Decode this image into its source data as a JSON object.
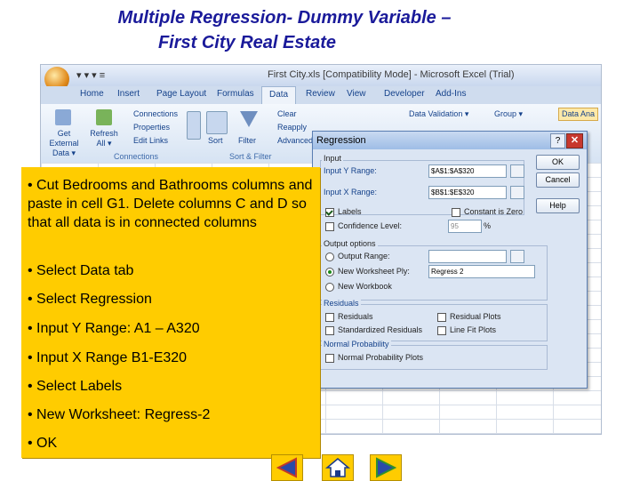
{
  "slide": {
    "title_line1": "Multiple Regression- Dummy Variable –",
    "title_line2": "First City Real Estate"
  },
  "excel": {
    "qat": "▾ ▾ ▾  ≡",
    "window_title": "First City.xls  [Compatibility Mode] - Microsoft Excel (Trial)",
    "tabs": [
      "Home",
      "Insert",
      "Page Layout",
      "Formulas",
      "Data",
      "Review",
      "View",
      "Developer",
      "Add-Ins"
    ],
    "active_tab": "Data",
    "ribbon": {
      "get_external": "Get External\nData ▾",
      "refresh": "Refresh\nAll ▾",
      "connections": "Connections",
      "properties": "Properties",
      "edit_links": "Edit Links",
      "sort": "Sort",
      "filter": "Filter",
      "clear": "Clear",
      "reapply": "Reapply",
      "advanced": "Advanced",
      "data_validation": "Data Validation ▾",
      "group": "Group ▾",
      "data_analysis": "Data Ana",
      "group_connections": "Connections",
      "group_sort_filter": "Sort & Filter"
    }
  },
  "dialog": {
    "title": "Regression",
    "help_glyph": "?",
    "close_glyph": "✕",
    "input_label": "Input",
    "input_y_label": "Input Y Range:",
    "input_y_value": "$A$1:$A$320",
    "input_x_label": "Input X Range:",
    "input_x_value": "$B$1:$E$320",
    "labels_label": "Labels",
    "constant_zero_label": "Constant is Zero",
    "confidence_label": "Confidence Level:",
    "confidence_value": "95",
    "percent": "%",
    "output_options_label": "Output options",
    "output_range_label": "Output Range:",
    "new_ws_ply_label": "New Worksheet Ply:",
    "new_ws_ply_value": "Regress 2",
    "new_workbook_label": "New Workbook",
    "residuals_group": "Residuals",
    "residuals_label": "Residuals",
    "std_residuals_label": "Standardized Residuals",
    "residual_plots_label": "Residual Plots",
    "line_fit_label": "Line Fit Plots",
    "normal_prob_group": "Normal Probability",
    "normal_plots_label": "Normal Probability Plots",
    "ok": "OK",
    "cancel": "Cancel",
    "help": "Help"
  },
  "callout": {
    "items": [
      "• Cut Bedrooms and Bathrooms columns and paste in cell G1.  Delete columns C and D so that all data is in connected columns",
      "• Select Data tab",
      "• Select Regression",
      "• Input Y Range:  A1 – A320",
      "• Input X Range B1-E320",
      "• Select Labels",
      "• New Worksheet: Regress-2",
      "• OK"
    ]
  },
  "nav": {
    "icons": [
      "previous-slide-icon",
      "home-icon",
      "next-slide-icon"
    ],
    "colors": {
      "button_bg": "#ffcc00",
      "arrow_blue": "#2a4aa8",
      "arrow_red": "#c0392b",
      "arrow_green": "#2f8f2f"
    }
  }
}
